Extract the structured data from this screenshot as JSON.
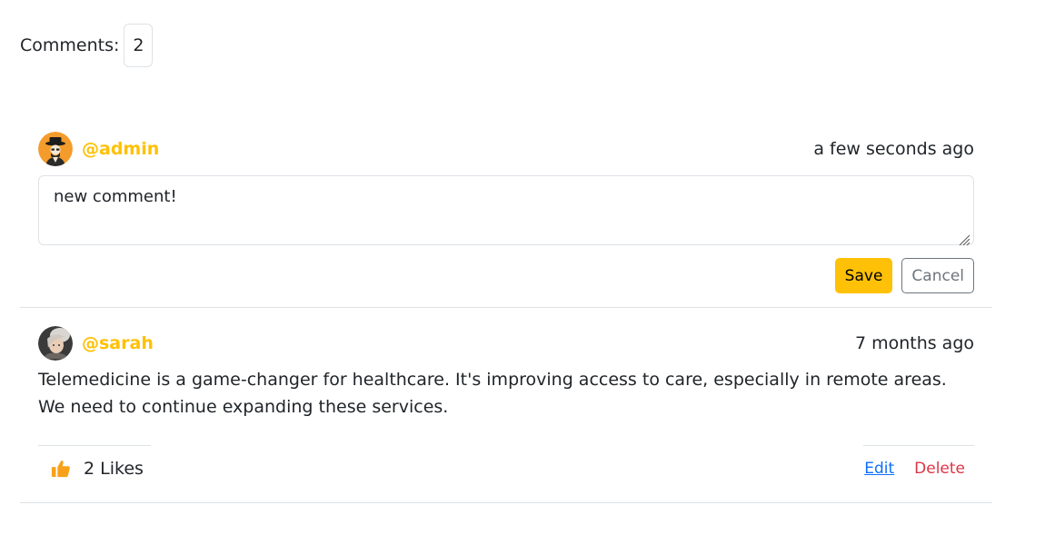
{
  "header": {
    "label": "Comments:",
    "count": "2"
  },
  "colors": {
    "accent": "#ffc107",
    "link": "#0d6efd",
    "danger": "#dc3545",
    "border": "#dee2e6",
    "secondary": "#6c757d"
  },
  "editing_comment": {
    "username": "@admin",
    "timestamp": "a few seconds ago",
    "avatar_icon": "avatar-admin-icon",
    "text": "new comment!",
    "save_label": "Save",
    "cancel_label": "Cancel"
  },
  "comments": [
    {
      "username": "@sarah",
      "timestamp": "7 months ago",
      "avatar_icon": "avatar-sarah-icon",
      "text": "Telemedicine is a game-changer for healthcare. It's improving access to care, especially in remote areas. We need to continue expanding these services.",
      "likes_label": "2 Likes",
      "like_icon": "thumbs-up-icon",
      "edit_label": "Edit",
      "delete_label": "Delete"
    }
  ]
}
